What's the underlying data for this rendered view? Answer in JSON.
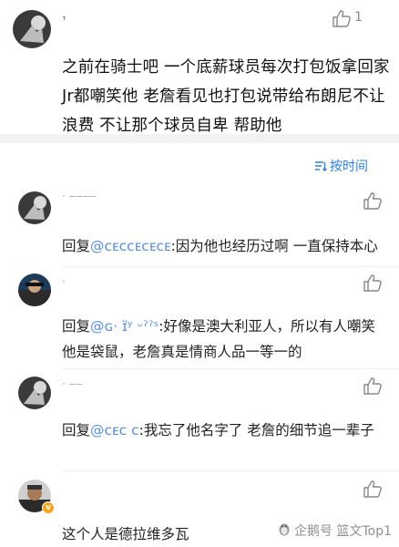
{
  "main_comment": {
    "username": "ᐪ",
    "like_count": "1",
    "text": "之前在骑士吧 一个底薪球员每次打包饭拿回家 Jr都嘲笑他 老詹看见也打包说带给布朗尼不让浪费 不让那个球员自卑 帮助他"
  },
  "sort": {
    "label": "按时间",
    "icon": "sort-icon"
  },
  "replies": [
    {
      "reply_prefix": "回复",
      "mention": "@ᴄᴇᴄᴄᴇᴄᴇᴄᴇ",
      "text": ":因为他也经历过啊 一直保持本心"
    },
    {
      "reply_prefix": "回复",
      "mention": "@ɢ· ɪ̈ʸ   ᵕˀˀˢ",
      "text": ":好像是澳大利亚人，所以有人嘲笑他是袋鼠，老詹真是情商人品一等一的"
    },
    {
      "reply_prefix": "回复",
      "mention": "@ᴄᴇᴄ ᴄ",
      "text": ":我忘了他名字了  老詹的细节追一辈子"
    },
    {
      "reply_prefix": "",
      "mention": "",
      "text": "这个人是德拉维多瓦"
    }
  ],
  "watermark": {
    "text": "企鹅号 篮文Top1"
  },
  "colors": {
    "link": "#2f7ed8",
    "mention": "#5c8fd6",
    "divider": "#f2f2f2"
  }
}
